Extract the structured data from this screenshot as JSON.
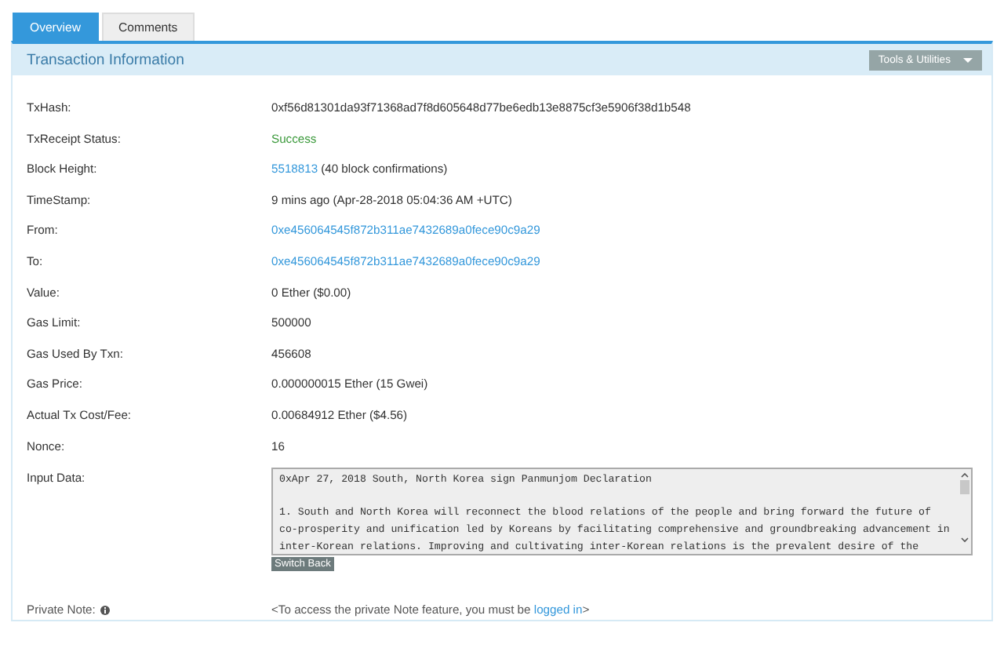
{
  "tabs": [
    {
      "label": "Overview",
      "selected": true
    },
    {
      "label": "Comments",
      "selected": false
    }
  ],
  "panel": {
    "title": "Transaction Information",
    "tools_button": "Tools & Utilities"
  },
  "rows": [
    {
      "label": "TxHash:",
      "parts": [
        {
          "kind": "text",
          "text": "0xf56d81301da93f71368ad7f8d605648d77be6edb13e8875cf3e5906f38d1b548"
        }
      ]
    },
    {
      "label": "TxReceipt Status:",
      "parts": [
        {
          "kind": "success",
          "text": "Success"
        }
      ]
    },
    {
      "label": "Block Height:",
      "parts": [
        {
          "kind": "link",
          "text": "5518813"
        },
        {
          "kind": "text",
          "text": "(40 block confirmations)"
        }
      ]
    },
    {
      "label": "TimeStamp:",
      "parts": [
        {
          "kind": "text",
          "text": "9 mins ago (Apr-28-2018 05:04:36 AM +UTC)"
        }
      ]
    },
    {
      "label": "From:",
      "parts": [
        {
          "kind": "link",
          "text": "0xe456064545f872b311ae7432689a0fece90c9a29"
        }
      ]
    },
    {
      "label": "To:",
      "parts": [
        {
          "kind": "link",
          "text": "0xe456064545f872b311ae7432689a0fece90c9a29"
        }
      ]
    },
    {
      "label": "Value:",
      "parts": [
        {
          "kind": "text",
          "text": "0 Ether ($0.00)"
        }
      ]
    },
    {
      "label": "Gas Limit:",
      "parts": [
        {
          "kind": "text",
          "text": "500000"
        }
      ]
    },
    {
      "label": "Gas Used By Txn:",
      "parts": [
        {
          "kind": "text",
          "text": "456608"
        }
      ]
    },
    {
      "label": "Gas Price:",
      "parts": [
        {
          "kind": "text",
          "text": "0.000000015 Ether (15 Gwei)"
        }
      ]
    },
    {
      "label": "Actual Tx Cost/Fee:",
      "parts": [
        {
          "kind": "text",
          "text": "0.00684912 Ether ($4.56)"
        }
      ]
    },
    {
      "label": "Nonce:",
      "parts": [
        {
          "kind": "text",
          "text": "16"
        }
      ]
    }
  ],
  "input_data": {
    "label": "Input Data:",
    "value": "0xApr 27, 2018 South, North Korea sign Panmunjom Declaration\n\n1. South and North Korea will reconnect the blood relations of the people and bring forward the future of co-prosperity and unification led by Koreans by facilitating comprehensive and groundbreaking advancement in inter-Korean relations. Improving and cultivating inter-Korean relations is the prevalent desire of the",
    "button": "Switch Back"
  },
  "private_note": {
    "label": "Private Note:",
    "text_before": "<To access the private Note feature, you must be",
    "link": "logged in",
    "text_after": ">"
  }
}
